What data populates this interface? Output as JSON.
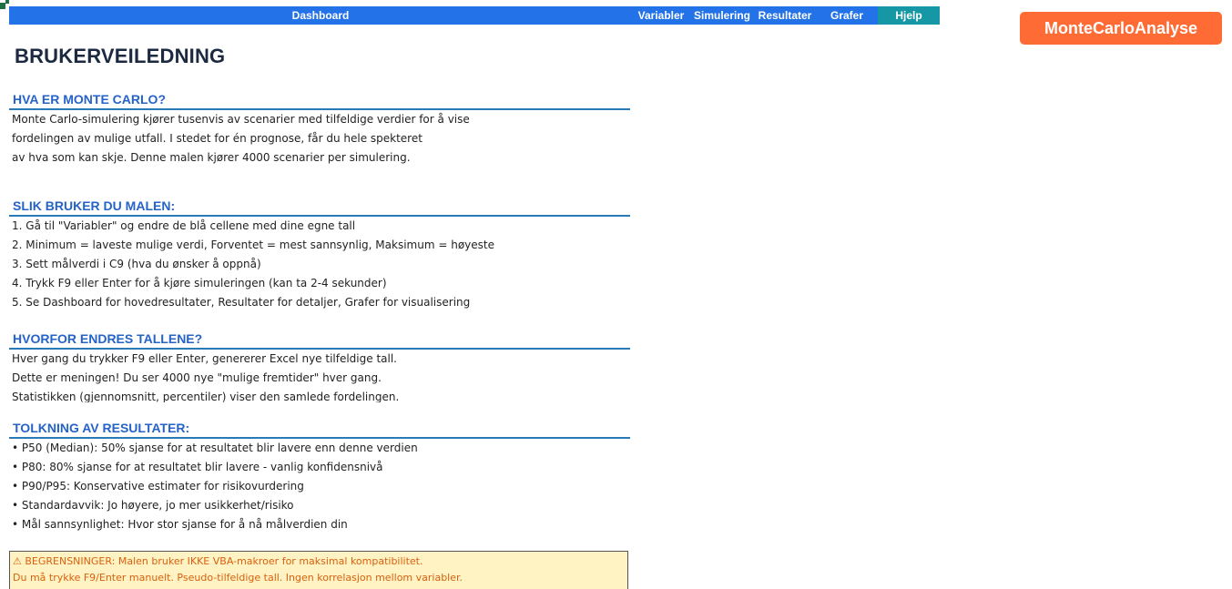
{
  "nav": {
    "dashboard": "Dashboard",
    "variabler": "Variabler",
    "simulering": "Simulering",
    "resultater": "Resultater",
    "grafer": "Grafer",
    "hjelp": "Hjelp",
    "active": "Hjelp"
  },
  "brand": {
    "label": "MonteCarloAnalyse",
    "color": "#ff6b35"
  },
  "page_title": "BRUKERVEILEDNING",
  "sections": [
    {
      "heading": "HVA ER MONTE CARLO?",
      "lines": [
        "Monte Carlo-simulering kjører tusenvis av scenarier med tilfeldige verdier for å vise",
        "fordelingen av mulige utfall. I stedet for én prognose, får du hele spekteret",
        "av hva som kan skje. Denne malen kjører 4000 scenarier per simulering."
      ]
    },
    {
      "heading": "SLIK BRUKER DU MALEN:",
      "lines": [
        "1. Gå til \"Variabler\" og endre de blå cellene med dine egne tall",
        "2. Minimum = laveste mulige verdi, Forventet = mest sannsynlig, Maksimum = høyeste",
        "3. Sett målverdi i C9 (hva du ønsker å oppnå)",
        "4. Trykk F9 eller Enter for å kjøre simuleringen (kan ta 2-4 sekunder)",
        "5. Se Dashboard for hovedresultater, Resultater for detaljer, Grafer for visualisering"
      ]
    },
    {
      "heading": "HVORFOR ENDRES TALLENE?",
      "lines": [
        "Hver gang du trykker F9 eller Enter, genererer Excel nye tilfeldige tall.",
        "Dette er meningen! Du ser 4000 nye \"mulige fremtider\" hver gang.",
        "Statistikken (gjennomsnitt, percentiler) viser den samlede fordelingen."
      ]
    },
    {
      "heading": "TOLKNING AV RESULTATER:",
      "lines": [
        "• P50 (Median): 50% sjanse for at resultatet blir lavere enn denne verdien",
        "• P80: 80% sjanse for at resultatet blir lavere - vanlig konfidensnivå",
        "• P90/P95: Konservative estimater for risikovurdering",
        "• Standardavvik: Jo høyere, jo mer usikkerhet/risiko",
        "• Mål sannsynlighet: Hvor stor sjanse for å nå målverdien din"
      ]
    }
  ],
  "warning": {
    "line1": "⚠ BEGRENSNINGER: Malen bruker IKKE VBA-makroer for maksimal kompatibilitet.",
    "line2": "Du må trykke F9/Enter manuelt. Pseudo-tilfeldige tall. Ingen korrelasjon mellom variabler."
  },
  "colors": {
    "nav_bar": "#2372e8",
    "nav_active": "#1697a6",
    "heading_text": "#2563c9",
    "heading_rule": "#2b7ab8",
    "warning_bg": "#fff3c4",
    "warning_text": "#d9600e"
  }
}
